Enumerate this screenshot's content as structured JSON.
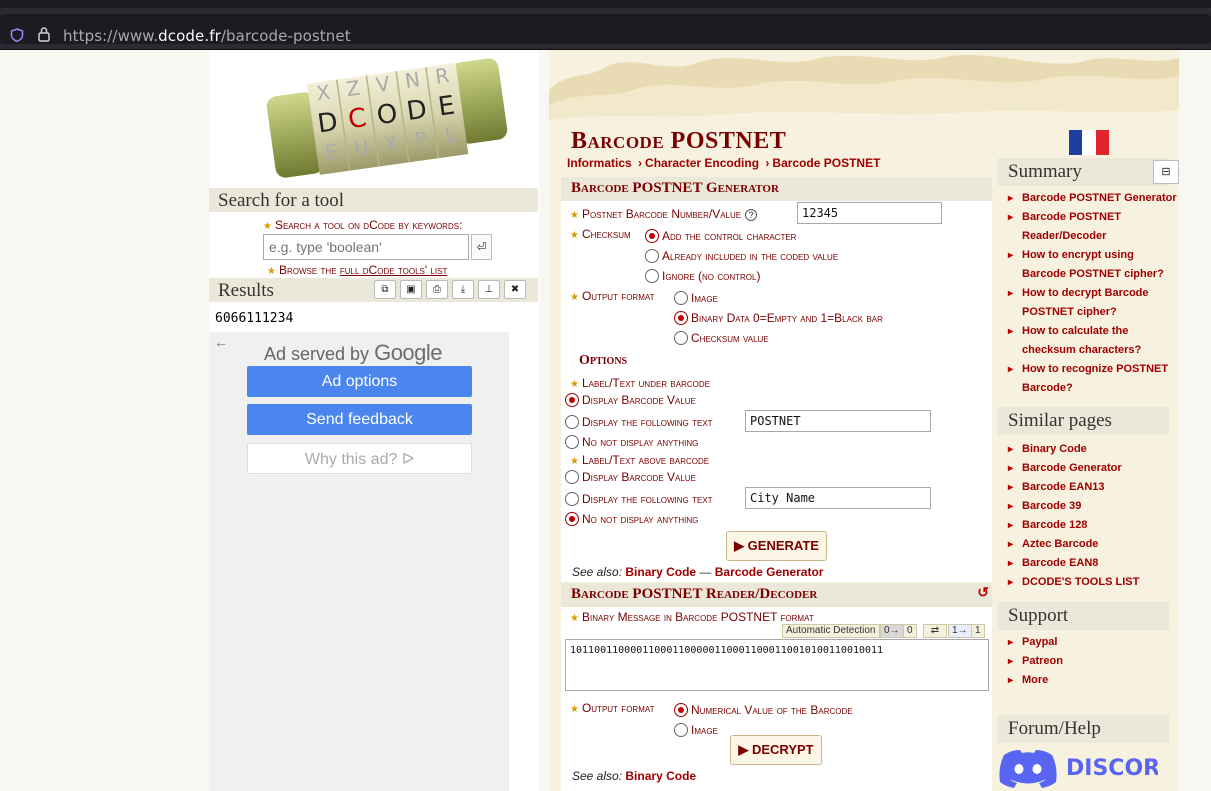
{
  "browser": {
    "url_prefix": "https://www.",
    "url_domain": "dcode.fr",
    "url_path": "/barcode-postnet"
  },
  "left": {
    "logo_text": "DCODE",
    "search_heading": "Search for a tool",
    "search_label": "Search a tool on dCode by keywords:",
    "search_placeholder": "e.g. type 'boolean'",
    "search_go": "⏎",
    "browse_prefix": "Browse the ",
    "browse_link": "full dCode tools' list",
    "results_heading": "Results",
    "result_value": "6066111234",
    "ad_served": "Ad served by",
    "ad_google": "Google",
    "ad_back": "←",
    "ad_options": "Ad options",
    "ad_feedback": "Send feedback",
    "ad_why": "Why this ad? ᐅ"
  },
  "main": {
    "title": "Barcode POSTNET",
    "breadcrumb": [
      "Informatics",
      "Character Encoding",
      "Barcode POSTNET"
    ],
    "breadcrumb_sep": "›",
    "generator": {
      "heading": "Barcode POSTNET Generator",
      "number_label": "Postnet Barcode Number/Value",
      "number_value": "12345",
      "checksum_label": "Checksum",
      "checksum_options": [
        "Add the control character",
        "Already included in the coded value",
        "Ignore (no control)"
      ],
      "output_label": "Output format",
      "output_options": [
        "Image",
        "Binary Data 0=Empty and 1=Black bar",
        "Checksum value"
      ],
      "options_heading": "Options",
      "under_label": "Label/Text under barcode",
      "under_opt1": "Display Barcode Value",
      "under_opt2": "Display the following text",
      "under_text": "POSTNET",
      "under_opt3": "No not display anything",
      "above_label": "Label/Text above barcode",
      "above_opt1": "Display Barcode Value",
      "above_opt2": "Display the following text",
      "above_text": "City Name",
      "above_opt3": "No not display anything",
      "generate_btn": "▶ GENERATE",
      "see_also": "See also:",
      "see_link1": "Binary Code",
      "see_dash": "—",
      "see_link2": "Barcode Generator"
    },
    "decoder": {
      "heading": "Barcode POSTNET Reader/Decoder",
      "reset_icon": "↺",
      "binary_label": "Binary Message in Barcode POSTNET format",
      "auto_detect": "Automatic Detection",
      "zero_btn": "0→",
      "zero_val": "0",
      "swap_btn": "⇄",
      "one_btn": "1→",
      "one_val": "1",
      "binary_value": "1011001100001100011000001100011000110010100110010011",
      "output_label": "Output format",
      "output_options": [
        "Numerical Value of the Barcode",
        "Image"
      ],
      "decrypt_btn": "▶ DECRYPT",
      "see_also": "See also:",
      "see_link1": "Binary Code"
    }
  },
  "sidebar": {
    "summary_heading": "Summary",
    "collapse_icon": "⊟",
    "summary_links": [
      "Barcode POSTNET Generator",
      "Barcode POSTNET Reader/Decoder",
      "How to encrypt using Barcode POSTNET cipher?",
      "How to decrypt Barcode POSTNET cipher?",
      "How to calculate the checksum characters?",
      "How to recognize POSTNET Barcode?"
    ],
    "similar_heading": "Similar pages",
    "similar_links": [
      "Binary Code",
      "Barcode Generator",
      "Barcode EAN13",
      "Barcode 39",
      "Barcode 128",
      "Aztec Barcode",
      "Barcode EAN8",
      "DCODE'S TOOLS LIST"
    ],
    "support_heading": "Support",
    "support_links": [
      "Paypal",
      "Patreon",
      "More"
    ],
    "forum_heading": "Forum/Help",
    "discord_text": "DISCORD"
  },
  "colors": {
    "accent": "#7a0000",
    "link": "#a00000",
    "header_bg": "#ece8d9",
    "ad_blue": "#4a86ee",
    "discord": "#5865f2"
  }
}
